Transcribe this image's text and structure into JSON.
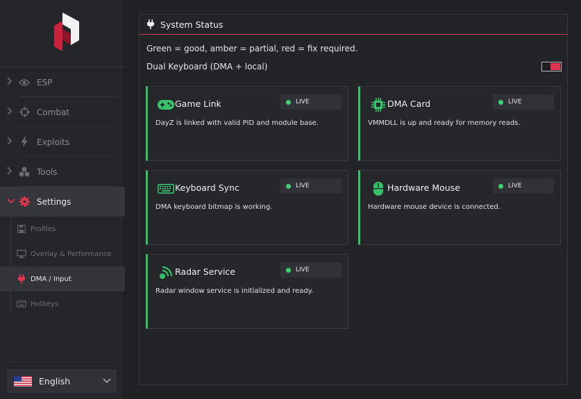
{
  "sidebar": {
    "nav": [
      {
        "label": "ESP",
        "icon": "eye-icon",
        "expanded": false
      },
      {
        "label": "Combat",
        "icon": "crosshair-icon",
        "expanded": false
      },
      {
        "label": "Exploits",
        "icon": "lightning-icon",
        "expanded": false
      },
      {
        "label": "Tools",
        "icon": "tools-icon",
        "expanded": false
      },
      {
        "label": "Settings",
        "icon": "gear-icon",
        "expanded": true
      }
    ],
    "settings_sub": [
      {
        "label": "Profiles",
        "icon": "floppy-icon"
      },
      {
        "label": "Overlay & Performance",
        "icon": "monitor-icon"
      },
      {
        "label": "DMA / Input",
        "icon": "plug-icon",
        "active": true
      },
      {
        "label": "Hotkeys",
        "icon": "keyboard-icon"
      }
    ],
    "language": {
      "label": "English",
      "flag": "us-flag-icon"
    }
  },
  "panel": {
    "title": "System Status",
    "note": "Green = good, amber = partial, red = fix required.",
    "dual_keyboard_label": "Dual Keyboard (DMA + local)",
    "dual_keyboard_enabled": true
  },
  "cards": [
    {
      "title": "Game Link",
      "status": "LIVE",
      "desc": "DayZ is linked with valid PID and module base.",
      "icon": "gamepad-icon"
    },
    {
      "title": "DMA Card",
      "status": "LIVE",
      "desc": "VMMDLL is up and ready for memory reads.",
      "icon": "chip-icon"
    },
    {
      "title": "Keyboard Sync",
      "status": "LIVE",
      "desc": "DMA keyboard bitmap is working.",
      "icon": "keyboard-icon"
    },
    {
      "title": "Hardware Mouse",
      "status": "LIVE",
      "desc": "Hardware mouse device is connected.",
      "icon": "mouse-icon"
    },
    {
      "title": "Radar Service",
      "status": "LIVE",
      "desc": "Radar window service is initialized and ready.",
      "icon": "radar-icon"
    }
  ],
  "colors": {
    "accent_red": "#d9344d",
    "status_green": "#37c26a",
    "background": "#202125"
  }
}
